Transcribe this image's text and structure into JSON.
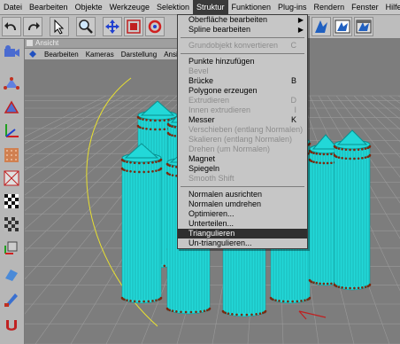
{
  "menubar": {
    "items": [
      "Datei",
      "Bearbeiten",
      "Objekte",
      "Werkzeuge",
      "Selektion",
      "Struktur",
      "Funktionen",
      "Plug-ins",
      "Rendern",
      "Fenster",
      "Hilfe"
    ],
    "active": "Struktur"
  },
  "viewport": {
    "title": "Ansicht",
    "menu": [
      "Bearbeiten",
      "Kameras",
      "Darstellung",
      "Ansich"
    ]
  },
  "dropdown": {
    "group1": [
      {
        "label": "Oberfläche bearbeiten",
        "submenu": true
      },
      {
        "label": "Spline bearbeiten",
        "submenu": true
      }
    ],
    "group2": [
      {
        "label": "Grundobjekt konvertieren",
        "shortcut": "C",
        "disabled": true
      }
    ],
    "group3": [
      {
        "label": "Punkte hinzufügen",
        "disabled": false
      },
      {
        "label": "Bevel",
        "disabled": true
      },
      {
        "label": "Brücke",
        "shortcut": "B",
        "disabled": false
      },
      {
        "label": "Polygone erzeugen",
        "disabled": false
      },
      {
        "label": "Extrudieren",
        "shortcut": "D",
        "disabled": true
      },
      {
        "label": "Innen extrudieren",
        "shortcut": "I",
        "disabled": true
      },
      {
        "label": "Messer",
        "shortcut": "K",
        "disabled": false
      },
      {
        "label": "Verschieben (entlang Normalen)",
        "disabled": true
      },
      {
        "label": "Skalieren (entlang Normalen)",
        "disabled": true
      },
      {
        "label": "Drehen (um Normalen)",
        "disabled": true
      },
      {
        "label": "Magnet",
        "disabled": false
      },
      {
        "label": "Spiegeln",
        "disabled": false
      },
      {
        "label": "Smooth Shift",
        "disabled": true
      }
    ],
    "group4": [
      {
        "label": "Normalen ausrichten"
      },
      {
        "label": "Normalen umdrehen"
      },
      {
        "label": "Optimieren..."
      },
      {
        "label": "Unterteilen..."
      },
      {
        "label": "Triangulieren",
        "highlighted": true
      },
      {
        "label": "Un-triangulieren..."
      }
    ]
  },
  "colors": {
    "menubar_bg": "#c8c8c8",
    "toolbar_bg": "#bdbdbd",
    "viewport_bg": "#7d7d7d",
    "mesh": "#22d8d8",
    "points": "#7a2a10",
    "highlight": "#2f2f2f",
    "curve": "#e8e030"
  },
  "icons": [
    "undo-icon",
    "redo-icon",
    "pointer-icon",
    "magnifier-icon",
    "move-icon",
    "scale-icon",
    "rotate-icon",
    "render-icon",
    "render-view-icon",
    "render-settings-icon"
  ]
}
